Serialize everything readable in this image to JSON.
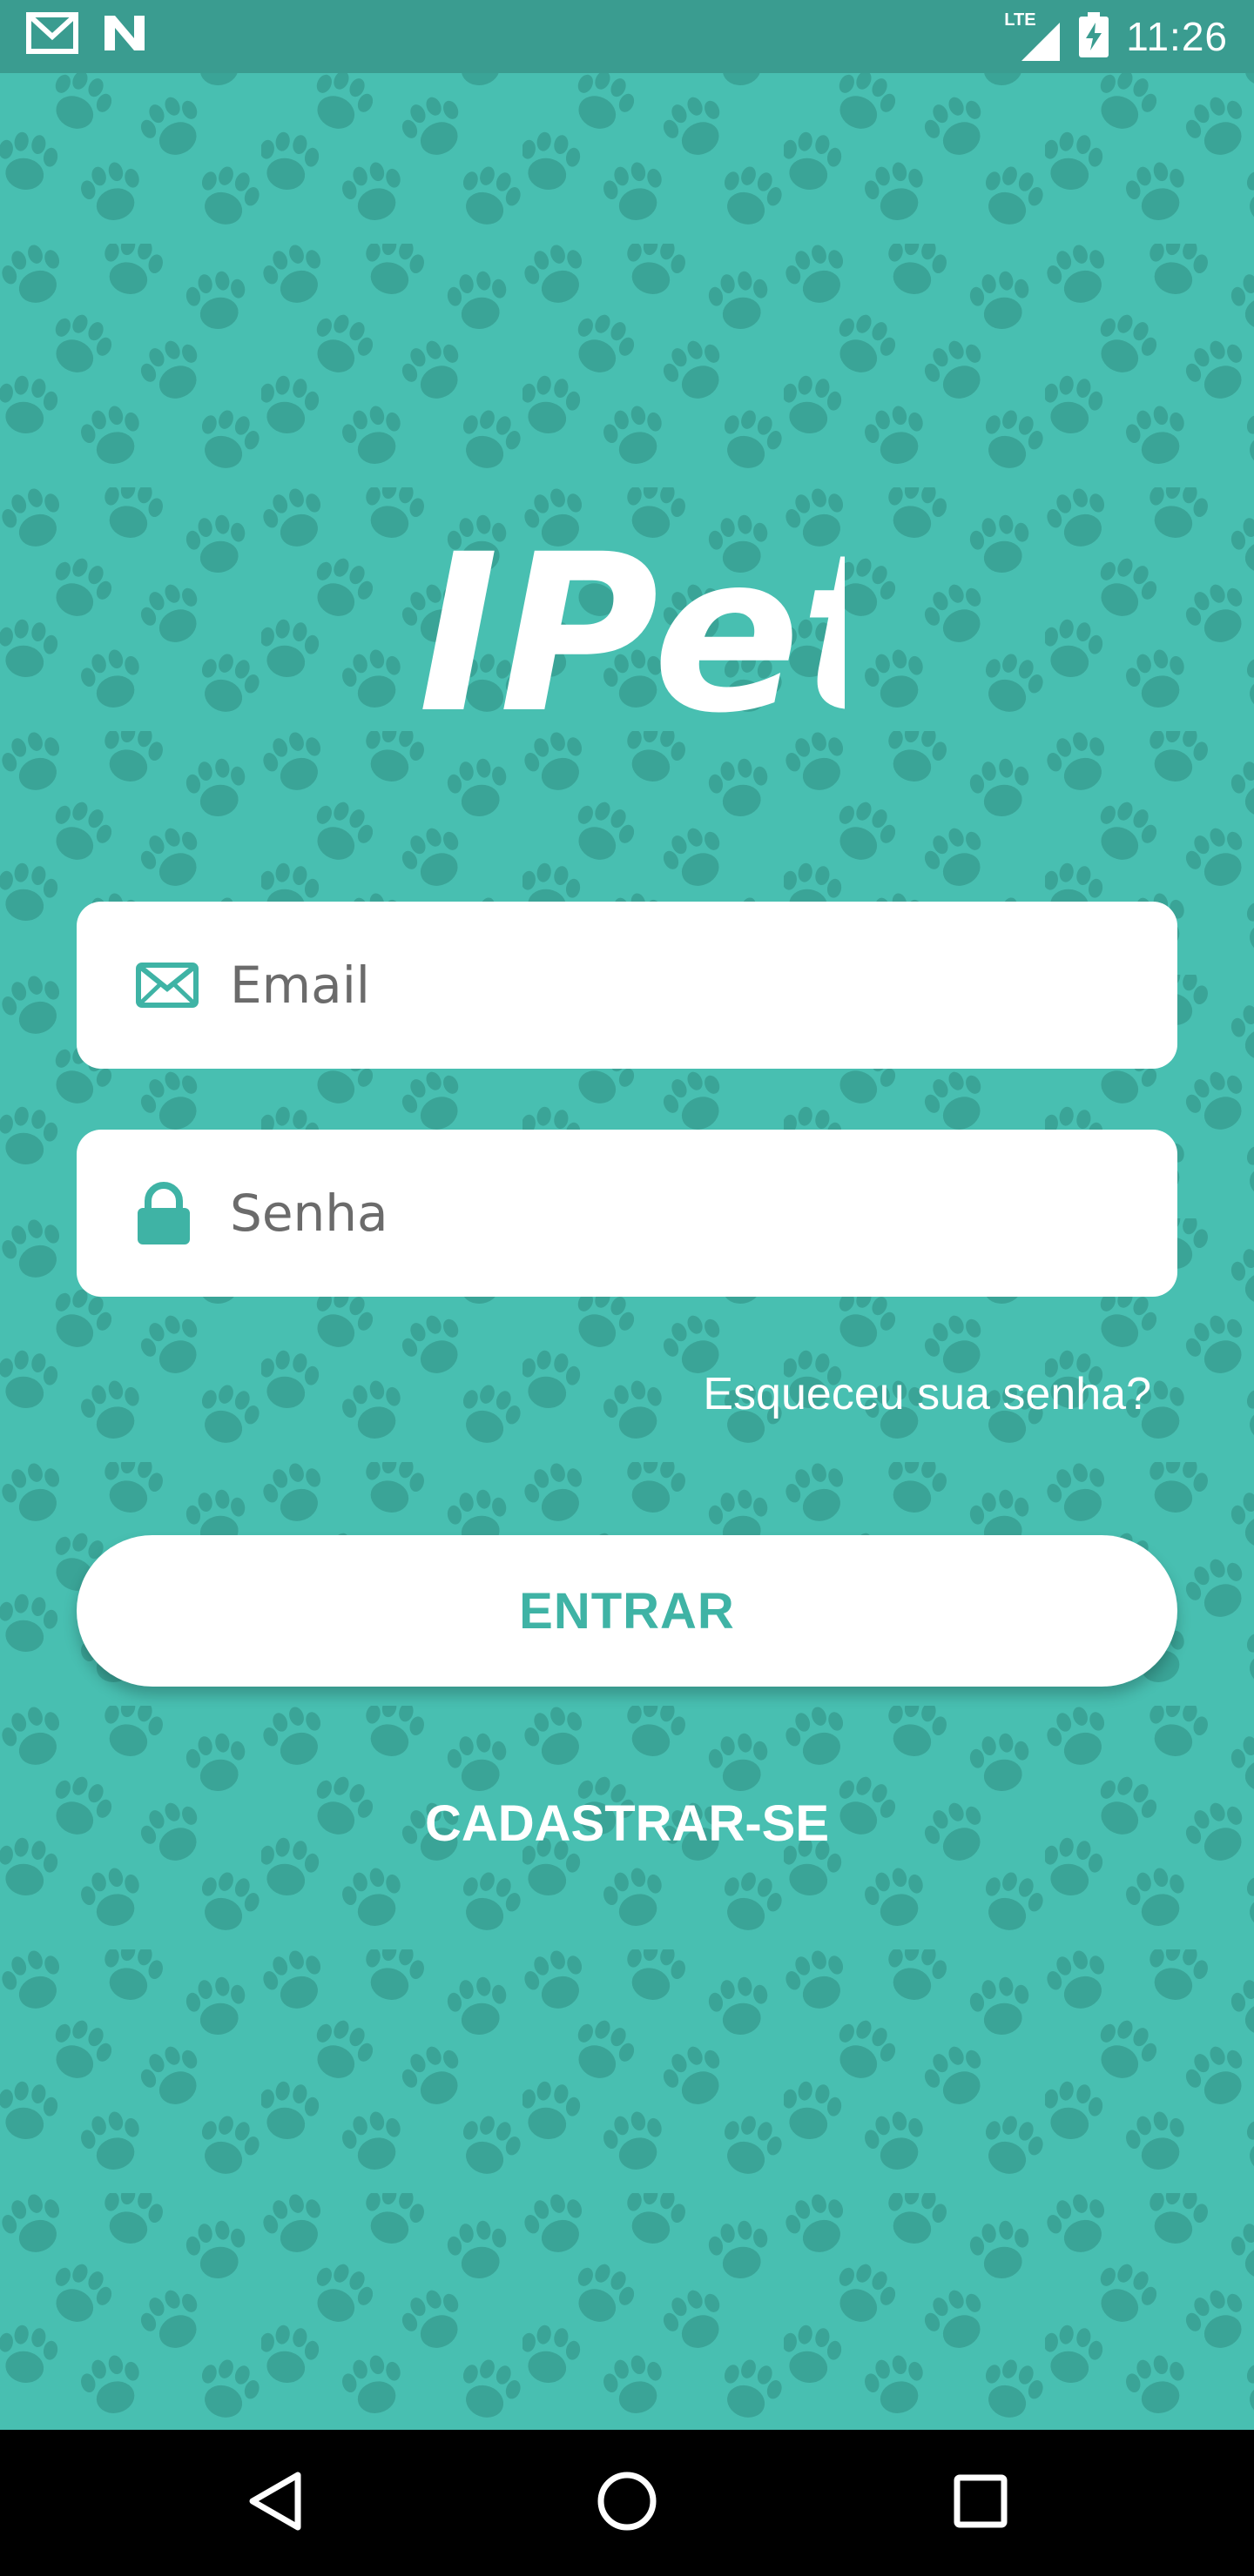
{
  "status_bar": {
    "time": "11:26",
    "network_label": "LTE",
    "left_icons": [
      "gmail-icon",
      "n-notification-icon"
    ],
    "right_icons": [
      "lte-signal-icon",
      "battery-charging-icon"
    ]
  },
  "app": {
    "logo_text": "IPet"
  },
  "login_form": {
    "email": {
      "placeholder": "Email",
      "value": "",
      "icon": "mail-icon"
    },
    "password": {
      "placeholder": "Senha",
      "value": "",
      "icon": "lock-icon"
    },
    "forgot_password_label": "Esqueceu sua senha?",
    "submit_label": "ENTRAR",
    "register_label": "CADASTRAR-SE"
  },
  "nav_bar": {
    "buttons": [
      "back-icon",
      "home-icon",
      "recents-icon"
    ]
  },
  "colors": {
    "background": "#48bfb1",
    "status_bar": "#3a9c90",
    "paw_pattern": "#3aa497",
    "accent": "#3fb3a5",
    "field_background": "#ffffff",
    "nav_bar": "#000000"
  }
}
